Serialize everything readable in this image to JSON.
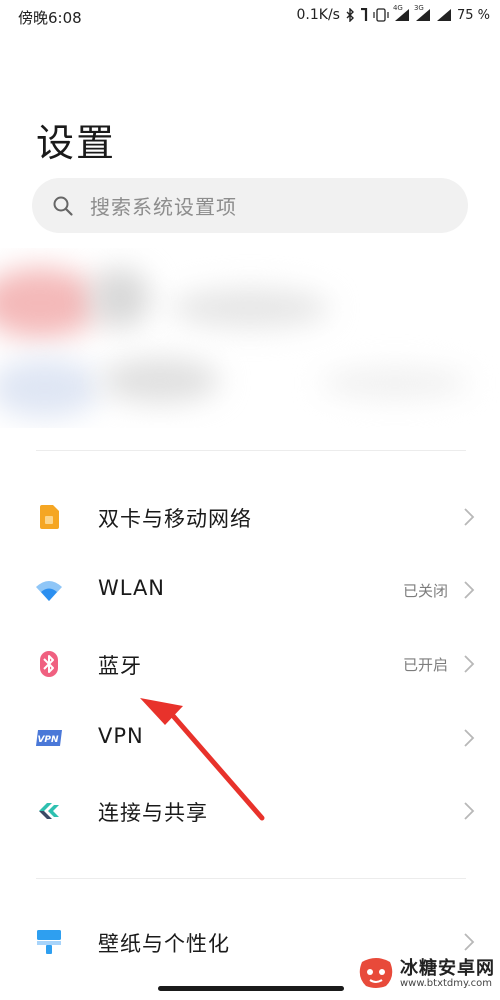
{
  "status_bar": {
    "time": "傍晚6:08",
    "network_speed": "0.1K/s",
    "sim1_label": "4G",
    "sim2_label": "3G",
    "battery": "75 %"
  },
  "page": {
    "title": "设置"
  },
  "search": {
    "placeholder": "搜索系统设置项"
  },
  "settings": [
    {
      "label": "双卡与移动网络",
      "value": "",
      "icon": "sim-card-icon",
      "color": "#f5a623"
    },
    {
      "label": "WLAN",
      "value": "已关闭",
      "icon": "wifi-icon",
      "color": "#2b8ff0"
    },
    {
      "label": "蓝牙",
      "value": "已开启",
      "icon": "bluetooth-icon",
      "color": "#f06080"
    },
    {
      "label": "VPN",
      "value": "",
      "icon": "vpn-icon",
      "color": "#4a78d8"
    },
    {
      "label": "连接与共享",
      "value": "",
      "icon": "share-icon",
      "color": "#2ec0b0"
    },
    {
      "label": "壁纸与个性化",
      "value": "",
      "icon": "wallpaper-icon",
      "color": "#2e9ff0"
    }
  ],
  "watermark": {
    "title": "冰糖安卓网",
    "url": "www.btxtdmy.com"
  },
  "colors": {
    "annotation_arrow": "#e8322b",
    "background": "#ffffff"
  }
}
